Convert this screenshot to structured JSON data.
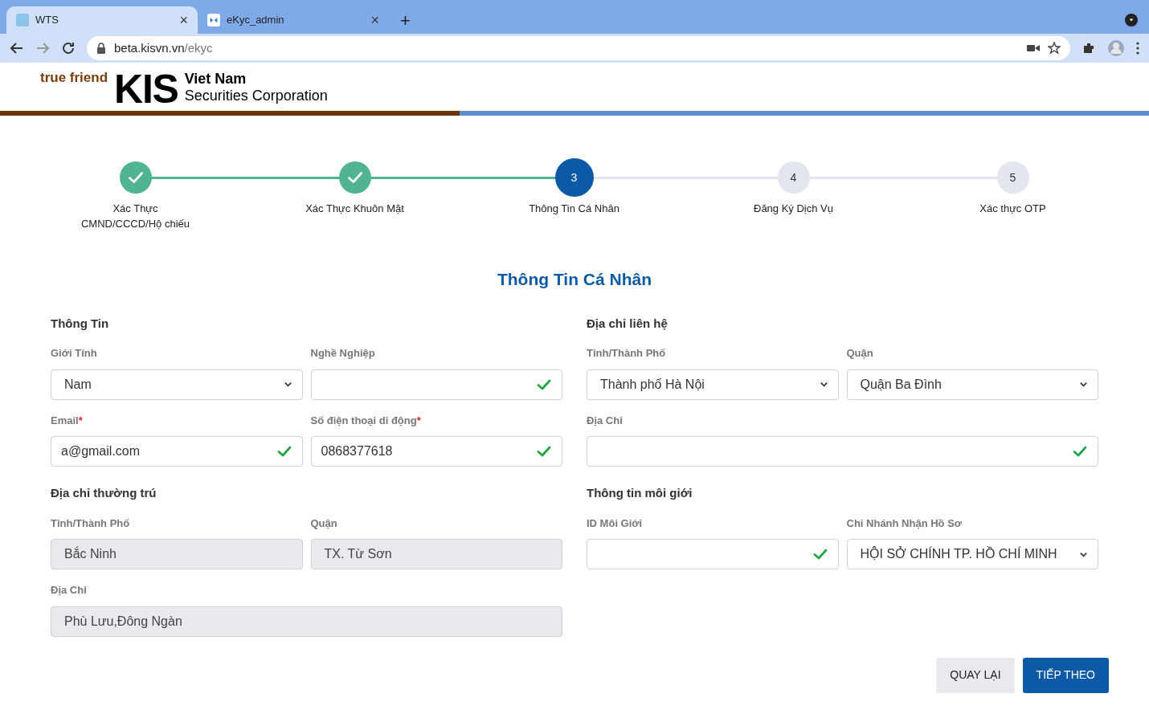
{
  "browser": {
    "tabs": [
      {
        "title": "WTS",
        "selected": true
      },
      {
        "title": "eKyc_admin",
        "selected": false
      }
    ],
    "new_tab": "+",
    "close": "×",
    "url_host": "beta.kisvn.vn",
    "url_path": "/ekyc"
  },
  "header": {
    "logo_tagline": "true friend",
    "logo_mark": "KIS",
    "logo_line_1": "Viet Nam",
    "logo_line_2": "Securities Corporation"
  },
  "steps": [
    {
      "label": "Xác Thực CMND/CCCD/Hộ chiếu",
      "done": true,
      "current": false
    },
    {
      "label": "Xác Thực Khuôn Mặt",
      "done": true,
      "current": false
    },
    {
      "number": "3",
      "label": "Thông Tin Cá Nhân",
      "done": false,
      "current": true
    },
    {
      "number": "4",
      "label": "Đăng Ký Dịch Vụ",
      "done": false,
      "current": false
    },
    {
      "number": "5",
      "label": "Xác thực OTP",
      "done": false,
      "current": false
    }
  ],
  "title": "Thông Tin Cá Nhân",
  "left_column": [
    {
      "heading": "Thông Tin",
      "fields": [
        {
          "label": "Giới Tính",
          "kind": "select",
          "value": "Nam",
          "required": false,
          "valid": false
        },
        {
          "label": "Nghề Nghiệp",
          "kind": "input",
          "required": false,
          "valid": true
        },
        {
          "label": "Email",
          "kind": "input",
          "value": "a@gmail.com",
          "required": true,
          "valid": true
        },
        {
          "label": "Số điện thoại di động",
          "kind": "input",
          "value": "0868377618",
          "required": true,
          "valid": true
        }
      ]
    },
    {
      "heading": "Địa chỉ thường trú",
      "fields": [
        {
          "label": "Tỉnh/Thành Phố",
          "kind": "readonly",
          "value": "Bắc Ninh",
          "required": false,
          "valid": false
        },
        {
          "label": "Quận",
          "kind": "readonly",
          "value": "TX. Từ Sơn",
          "required": false,
          "valid": false
        },
        {
          "label": "Địa Chỉ",
          "kind": "readonly",
          "value": "Phù Lưu,Đông Ngàn",
          "required": false,
          "valid": false
        }
      ]
    }
  ],
  "right_column": [
    {
      "heading": "Địa chỉ liên hệ",
      "fields": [
        {
          "label": "Tỉnh/Thành Phố",
          "kind": "select",
          "value": "Thành phố Hà Nội",
          "required": false,
          "valid": false
        },
        {
          "label": "Quận",
          "kind": "select",
          "value": "Quận Ba Đình",
          "required": false,
          "valid": false
        },
        {
          "label": "Địa Chỉ",
          "kind": "input",
          "required": false,
          "valid": true
        }
      ]
    },
    {
      "heading": "Thông tin môi giới",
      "fields": [
        {
          "label": "ID Môi Giới",
          "kind": "input",
          "required": false,
          "valid": true
        },
        {
          "label": "Chi Nhánh Nhận Hồ Sơ",
          "kind": "select",
          "value": "HỘI SỞ CHÍNH TP. HỒ CHÍ MINH",
          "required": false,
          "valid": false
        }
      ]
    }
  ],
  "required_mark": "*",
  "buttons": [
    {
      "label": "QUAY LẠI",
      "kind": "secondary"
    },
    {
      "label": "TIẾP THEO",
      "kind": "primary"
    }
  ]
}
